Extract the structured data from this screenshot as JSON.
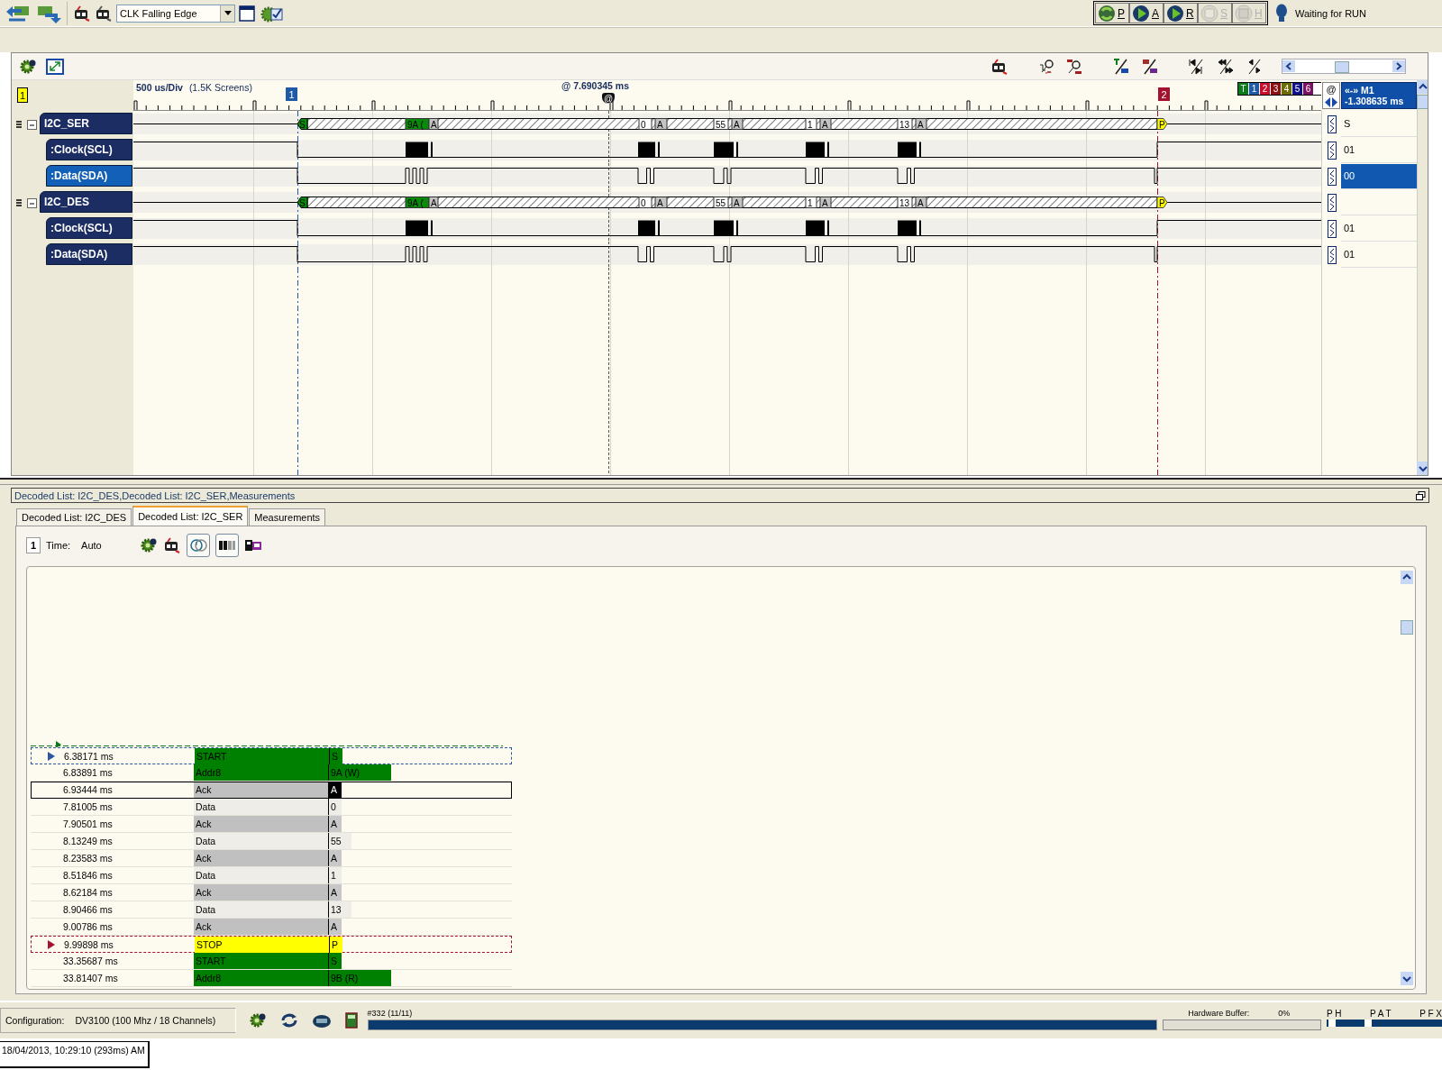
{
  "toolbar": {
    "trigger_select": {
      "value": "CLK Falling Edge"
    },
    "run_buttons": [
      {
        "label": "P",
        "kind": "cycle",
        "disabled": false
      },
      {
        "label": "A",
        "kind": "play",
        "disabled": false
      },
      {
        "label": "R",
        "kind": "play",
        "disabled": false
      },
      {
        "label": "S",
        "kind": "stop",
        "disabled": true
      },
      {
        "label": "H",
        "kind": "halt",
        "disabled": true
      }
    ],
    "status": "Waiting for RUN"
  },
  "waveform": {
    "page_badge": "1",
    "scale": "500 us/Div",
    "screens": "(1.5K Screens)",
    "cursor_time": "@ 7.690345 ms",
    "cursor_mark": "@",
    "markers": [
      {
        "label": "1",
        "color": "#1f5aa6"
      },
      {
        "label": "2",
        "color": "#a3122e"
      }
    ],
    "marker_tabs": [
      {
        "label": "T",
        "color": "#0a7a1a"
      },
      {
        "label": "1",
        "color": "#1f5aa6"
      },
      {
        "label": "2",
        "color": "#c8102e"
      },
      {
        "label": "3",
        "color": "#8b1010"
      },
      {
        "label": "4",
        "color": "#6b6b00"
      },
      {
        "label": "5",
        "color": "#10108a"
      },
      {
        "label": "6",
        "color": "#7a1060"
      }
    ],
    "at_label": "@",
    "measurement": {
      "title": "«-» M1",
      "value": "-1.308635 ms"
    },
    "signals": [
      {
        "name": "I2C_SER",
        "kind": "bus",
        "expanded": true,
        "selected": false,
        "value": "S",
        "segments": [
          {
            "label": "S",
            "kind": "start"
          },
          {
            "label": "9A (",
            "kind": "address"
          },
          {
            "label": "A",
            "kind": "ack"
          },
          {
            "label": "0",
            "kind": "data"
          },
          {
            "label": "A",
            "kind": "ack"
          },
          {
            "label": "55",
            "kind": "data"
          },
          {
            "label": "A",
            "kind": "ack"
          },
          {
            "label": "1",
            "kind": "data"
          },
          {
            "label": "A",
            "kind": "ack"
          },
          {
            "label": "13",
            "kind": "data"
          },
          {
            "label": "A",
            "kind": "ack"
          },
          {
            "label": "P",
            "kind": "stop"
          }
        ],
        "children": [
          {
            "name": ":Clock(SCL)",
            "kind": "clock",
            "selected": false,
            "value": "01"
          },
          {
            "name": ":Data(SDA)",
            "kind": "data",
            "selected": true,
            "value": "00"
          }
        ]
      },
      {
        "name": "I2C_DES",
        "kind": "bus",
        "expanded": true,
        "selected": false,
        "segments": [
          {
            "label": "S",
            "kind": "start"
          },
          {
            "label": "9A (",
            "kind": "address"
          },
          {
            "label": "A",
            "kind": "ack"
          },
          {
            "label": "0",
            "kind": "data"
          },
          {
            "label": "A",
            "kind": "ack"
          },
          {
            "label": "55",
            "kind": "data"
          },
          {
            "label": "A",
            "kind": "ack"
          },
          {
            "label": "1",
            "kind": "data"
          },
          {
            "label": "A",
            "kind": "ack"
          },
          {
            "label": "13",
            "kind": "data"
          },
          {
            "label": "A",
            "kind": "ack"
          },
          {
            "label": "P",
            "kind": "stop"
          }
        ],
        "children": [
          {
            "name": ":Clock(SCL)",
            "kind": "clock",
            "selected": false,
            "value": "01"
          },
          {
            "name": ":Data(SDA)",
            "kind": "data",
            "selected": false,
            "value": "01"
          }
        ]
      }
    ]
  },
  "decoded": {
    "title": "Decoded List: I2C_DES,Decoded List: I2C_SER,Measurements",
    "tabs": [
      {
        "label": "Decoded List: I2C_DES",
        "selected": false
      },
      {
        "label": "Decoded List: I2C_SER",
        "selected": true
      },
      {
        "label": "Measurements",
        "selected": false
      }
    ],
    "toolbar": {
      "page": "1",
      "time_label": "Time:",
      "time_value": "Auto",
      "toggles": [
        {
          "kind": "timing",
          "on": true
        },
        {
          "kind": "ascii",
          "on": true
        }
      ]
    },
    "rows": [
      {
        "time": "6.38171 ms",
        "type": "START",
        "value": "S",
        "kind": "start",
        "selected": false,
        "color": "#2a55a0"
      },
      {
        "time": "6.83891 ms",
        "type": "Addr8",
        "value": "9A (W)",
        "kind": "address",
        "selected": false
      },
      {
        "time": "6.93444 ms",
        "type": "Ack",
        "value": "A",
        "kind": "ack",
        "selected": true
      },
      {
        "time": "7.81005 ms",
        "type": "Data",
        "value": "0",
        "kind": "data",
        "selected": false
      },
      {
        "time": "7.90501 ms",
        "type": "Ack",
        "value": "A",
        "kind": "ack",
        "selected": false
      },
      {
        "time": "8.13249 ms",
        "type": "Data",
        "value": "55",
        "kind": "data",
        "selected": false
      },
      {
        "time": "8.23583 ms",
        "type": "Ack",
        "value": "A",
        "kind": "ack",
        "selected": false
      },
      {
        "time": "8.51846 ms",
        "type": "Data",
        "value": "1",
        "kind": "data",
        "selected": false
      },
      {
        "time": "8.62184 ms",
        "type": "Ack",
        "value": "A",
        "kind": "ack",
        "selected": false
      },
      {
        "time": "8.90466 ms",
        "type": "Data",
        "value": "13",
        "kind": "data",
        "selected": false
      },
      {
        "time": "9.00786 ms",
        "type": "Ack",
        "value": "A",
        "kind": "ack",
        "selected": false
      },
      {
        "time": "9.99898 ms",
        "type": "STOP",
        "value": "P",
        "kind": "stop",
        "selected": false,
        "color": "#a3122e"
      },
      {
        "time": "33.35687 ms",
        "type": "START",
        "value": "S",
        "kind": "start",
        "selected": false
      },
      {
        "time": "33.81407 ms",
        "type": "Addr8",
        "value": "9B (R)",
        "kind": "address",
        "selected": false
      }
    ]
  },
  "status_bar": {
    "config_label": "Configuration:",
    "config_value": "DV3100 (100 Mhz / 18 Channels)",
    "capture": {
      "label": "#332 (11/11)",
      "level": 1
    },
    "buffer": {
      "label": "Hardware Buffer:",
      "value": "0%",
      "level": 0
    },
    "modes": [
      "P H",
      "P A T",
      "P F X"
    ],
    "timestamp": "18/04/2013, 10:29:10 (293ms) AM"
  }
}
